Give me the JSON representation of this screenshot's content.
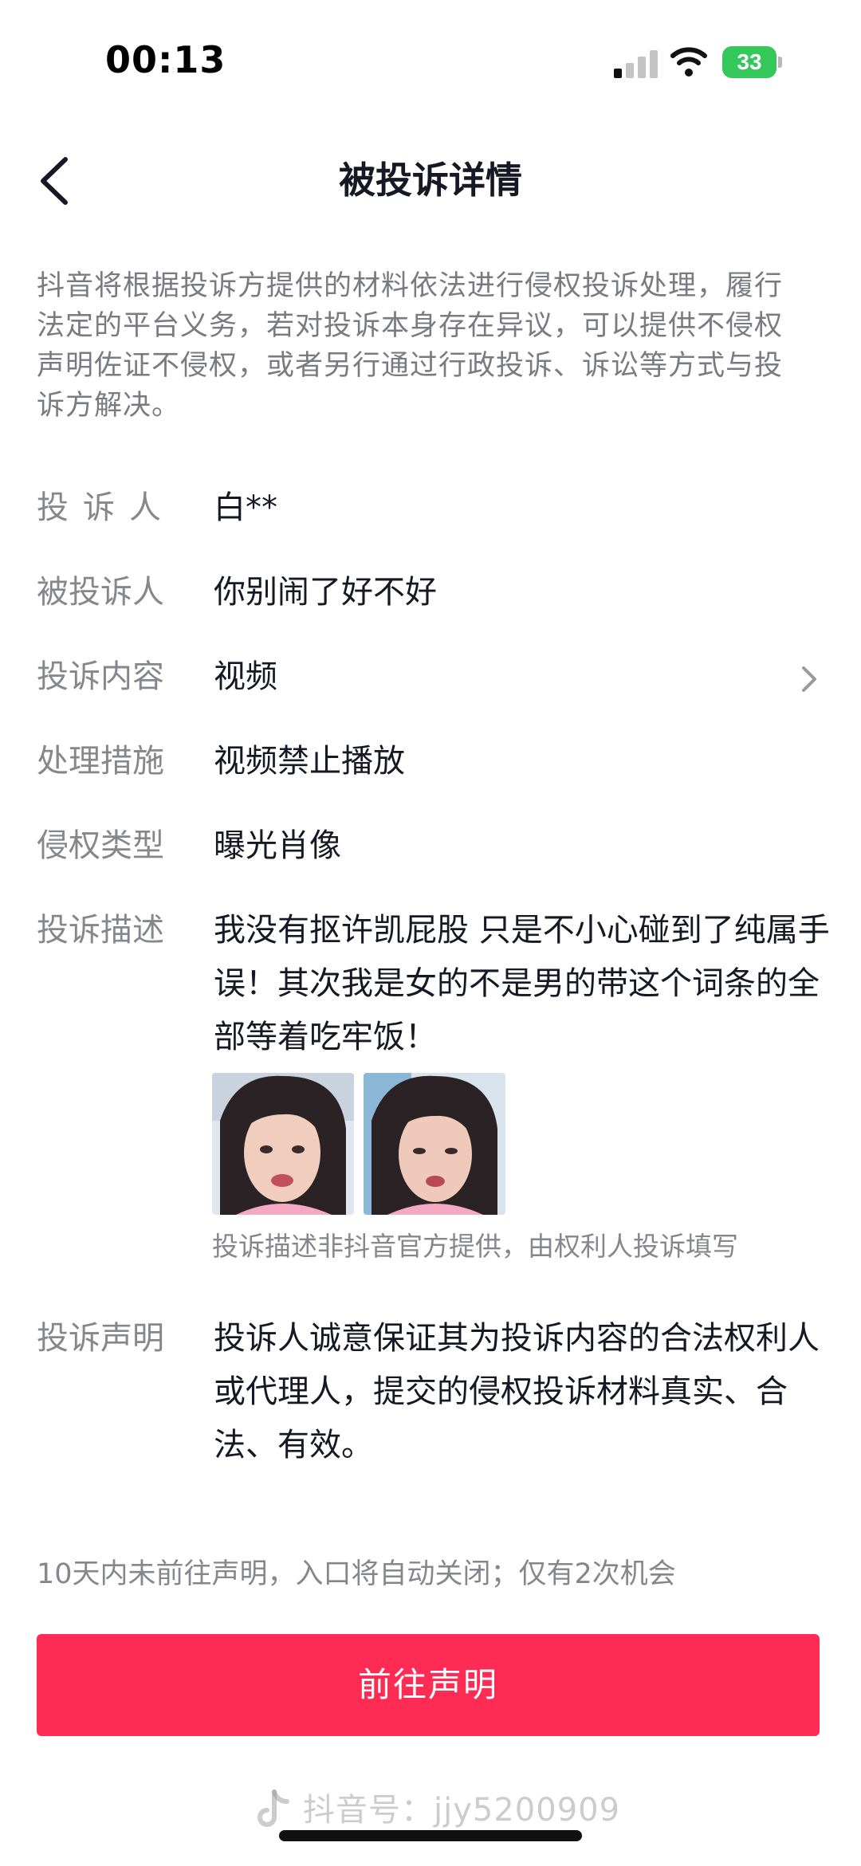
{
  "status_bar": {
    "time": "00:13",
    "battery": "33",
    "battery_color": "#34c759"
  },
  "header": {
    "title": "被投诉详情",
    "back_icon": "chevron-left-icon"
  },
  "notice": "抖音将根据投诉方提供的材料依法进行侵权投诉处理，履行法定的平台义务，若对投诉本身存在异议，可以提供不侵权声明佐证不侵权，或者另行通过行政投诉、诉讼等方式与投诉方解决。",
  "details": {
    "complainant": {
      "label": "投诉人",
      "value": "白**"
    },
    "respondent": {
      "label": "被投诉人",
      "value": "你别闹了好不好"
    },
    "content": {
      "label": "投诉内容",
      "value": "视频",
      "icon": "chevron-right-icon"
    },
    "measure": {
      "label": "处理措施",
      "value": "视频禁止播放"
    },
    "type": {
      "label": "侵权类型",
      "value": "曝光肖像"
    },
    "description": {
      "label": "投诉描述",
      "value": "我没有抠许凯屁股 只是不小心碰到了纯属手误！其次我是女的不是男的带这个词条的全部等着吃牢饭！",
      "image_note": "投诉描述非抖音官方提供，由权利人投诉填写"
    },
    "statement": {
      "label": "投诉声明",
      "value": "投诉人诚意保证其为投诉内容的合法权利人或代理人，提交的侵权投诉材料真实、合法、有效。"
    }
  },
  "footer": {
    "note": "10天内未前往声明，入口将自动关闭；仅有2次机会",
    "button_label": "前往声明",
    "button_color": "#fe2c55"
  },
  "watermark": "抖音号：jjy5200909"
}
